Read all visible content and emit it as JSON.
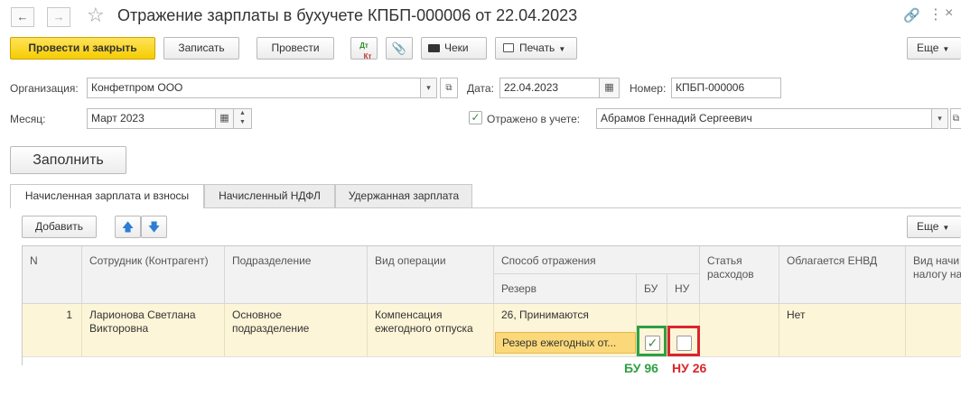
{
  "window": {
    "title": "Отражение зарплаты в бухучете КПБП-000006 от 22.04.2023"
  },
  "toolbar": {
    "post_close": "Провести и закрыть",
    "save": "Записать",
    "post": "Провести",
    "dtkt_dt": "Дт",
    "dtkt_kt": "Кт",
    "checks": "Чеки",
    "print": "Печать",
    "more": "Еще"
  },
  "form": {
    "org_label": "Организация:",
    "org_value": "Конфетпром ООО",
    "date_label": "Дата:",
    "date_value": "22.04.2023",
    "number_label": "Номер:",
    "number_value": "КПБП-000006",
    "month_label": "Месяц:",
    "month_value": "Март 2023",
    "reflected_label": "Отражено в учете:",
    "responsible_value": "Абрамов Геннадий Сергеевич",
    "fill_button": "Заполнить"
  },
  "tabs": [
    {
      "label": "Начисленная зарплата и взносы"
    },
    {
      "label": "Начисленный НДФЛ"
    },
    {
      "label": "Удержанная зарплата"
    }
  ],
  "table_toolbar": {
    "add": "Добавить",
    "more": "Еще"
  },
  "table": {
    "headers": {
      "n": "N",
      "employee": "Сотрудник (Контрагент)",
      "department": "Подразделение",
      "operation": "Вид операции",
      "method": "Способ отражения",
      "reserve": "Резерв",
      "bu": "БУ",
      "nu": "НУ",
      "expense_item": "Статья расходов",
      "envd": "Облагается ЕНВД",
      "tax_type": "Вид начи налогу на"
    },
    "rows": [
      {
        "n": "1",
        "employee": "Ларионова Светлана Викторовна",
        "department": "Основное подразделение",
        "operation": "Компенсация ежегодного отпуска",
        "method": "26, Принимаются",
        "reserve": "Резерв ежегодных от...",
        "bu_checked": true,
        "nu_checked": false,
        "envd": "Нет"
      }
    ]
  },
  "annotations": {
    "bu": "БУ 96",
    "nu": "НУ 26",
    "bu_color": "#2ea043",
    "nu_color": "#d9262c"
  }
}
